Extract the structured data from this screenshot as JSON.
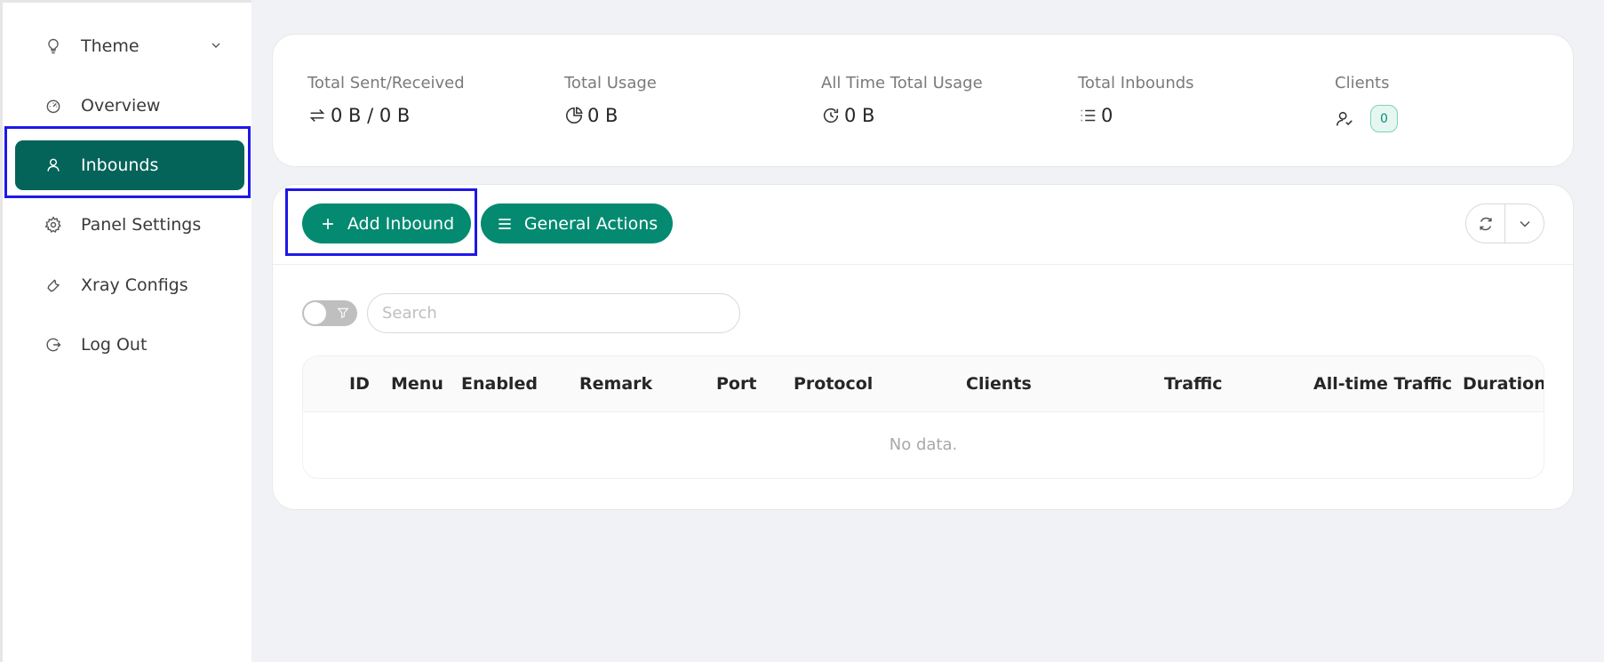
{
  "sidebar": {
    "items": [
      {
        "label": "Theme",
        "icon": "bulb-icon"
      },
      {
        "label": "Overview",
        "icon": "dashboard-icon"
      },
      {
        "label": "Inbounds",
        "icon": "user-icon",
        "active": true
      },
      {
        "label": "Panel Settings",
        "icon": "gear-icon"
      },
      {
        "label": "Xray Configs",
        "icon": "tool-icon"
      },
      {
        "label": "Log Out",
        "icon": "logout-icon"
      }
    ]
  },
  "stats": {
    "sent_received": {
      "label": "Total Sent/Received",
      "value": "0 B / 0 B"
    },
    "usage": {
      "label": "Total Usage",
      "value": "0 B"
    },
    "all_time": {
      "label": "All Time Total Usage",
      "value": "0 B"
    },
    "inbounds": {
      "label": "Total Inbounds",
      "value": "0"
    },
    "clients": {
      "label": "Clients",
      "value": "0"
    }
  },
  "toolbar": {
    "add_inbound": "Add Inbound",
    "general_actions": "General Actions"
  },
  "search": {
    "placeholder": "Search"
  },
  "table": {
    "columns": [
      "ID",
      "Menu",
      "Enabled",
      "Remark",
      "Port",
      "Protocol",
      "Clients",
      "Traffic",
      "All-time Traffic",
      "Duration"
    ],
    "empty_text": "No data."
  },
  "colors": {
    "accent": "#038a70",
    "active_nav": "#04645a",
    "highlight": "#1f17e8",
    "background": "#f0f2f5"
  }
}
